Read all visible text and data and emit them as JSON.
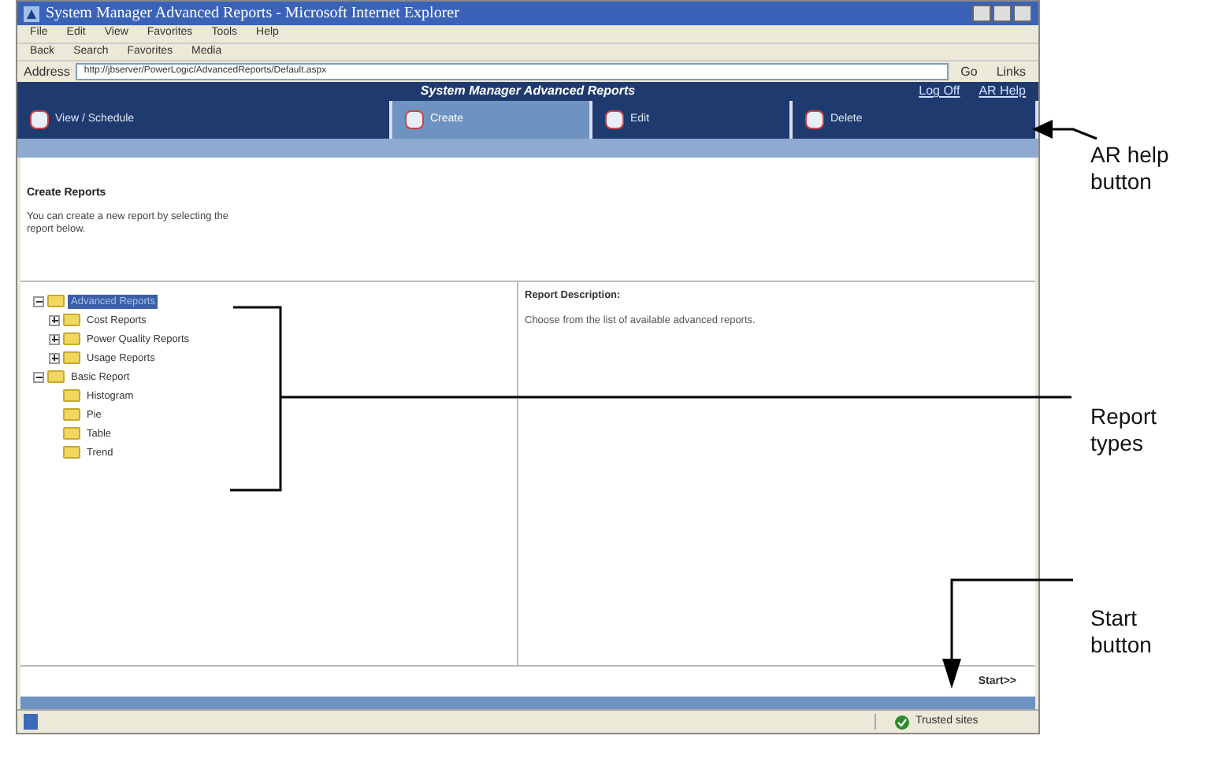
{
  "window": {
    "title": "System Manager Advanced Reports - Microsoft Internet Explorer"
  },
  "menu": [
    "File",
    "Edit",
    "View",
    "Favorites",
    "Tools",
    "Help"
  ],
  "toolbar": [
    "Back",
    "Search",
    "Favorites",
    "Media"
  ],
  "address": {
    "label": "Address",
    "value": "http://jbserver/PowerLogic/AdvancedReports/Default.aspx",
    "go": "Go",
    "links": "Links"
  },
  "app": {
    "title": "System Manager Advanced Reports",
    "links": [
      "Log Off",
      "AR Help"
    ]
  },
  "tabs": [
    {
      "label": "View / Schedule",
      "selected": false
    },
    {
      "label": "Create",
      "selected": true
    },
    {
      "label": "Edit",
      "selected": false
    },
    {
      "label": "Delete",
      "selected": false
    }
  ],
  "section": {
    "title": "Create Reports",
    "intro": "You can create a new report by selecting the report below."
  },
  "tree": [
    {
      "label": "Advanced Reports",
      "selected": true,
      "expanded": true,
      "children": [
        {
          "label": "Cost Reports",
          "selected": false,
          "expanded": false
        },
        {
          "label": "Power Quality Reports",
          "selected": false,
          "expanded": false
        },
        {
          "label": "Usage Reports",
          "selected": false,
          "expanded": false
        }
      ]
    },
    {
      "label": "Basic Report",
      "selected": false,
      "expanded": true,
      "children": [
        {
          "label": "Histogram",
          "selected": false
        },
        {
          "label": "Pie",
          "selected": false
        },
        {
          "label": "Table",
          "selected": false
        },
        {
          "label": "Trend",
          "selected": false
        }
      ]
    }
  ],
  "description": {
    "heading": "Report Description:",
    "text": "Choose from the list of available advanced reports."
  },
  "start_button": "Start>>",
  "status_bar": {
    "zone": "Trusted sites"
  },
  "callouts": [
    {
      "text": "AR help button"
    },
    {
      "text": "Report types"
    },
    {
      "text": "Start button"
    }
  ]
}
